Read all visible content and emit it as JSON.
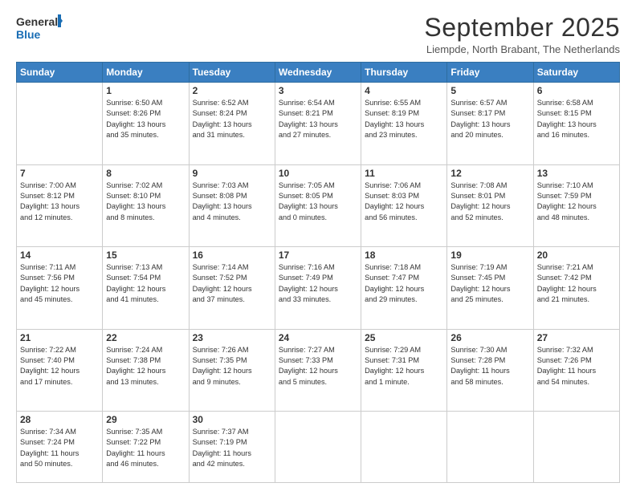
{
  "header": {
    "logo_line1": "General",
    "logo_line2": "Blue",
    "month": "September 2025",
    "location": "Liempde, North Brabant, The Netherlands"
  },
  "days_of_week": [
    "Sunday",
    "Monday",
    "Tuesday",
    "Wednesday",
    "Thursday",
    "Friday",
    "Saturday"
  ],
  "weeks": [
    [
      {
        "day": "",
        "info": ""
      },
      {
        "day": "1",
        "info": "Sunrise: 6:50 AM\nSunset: 8:26 PM\nDaylight: 13 hours\nand 35 minutes."
      },
      {
        "day": "2",
        "info": "Sunrise: 6:52 AM\nSunset: 8:24 PM\nDaylight: 13 hours\nand 31 minutes."
      },
      {
        "day": "3",
        "info": "Sunrise: 6:54 AM\nSunset: 8:21 PM\nDaylight: 13 hours\nand 27 minutes."
      },
      {
        "day": "4",
        "info": "Sunrise: 6:55 AM\nSunset: 8:19 PM\nDaylight: 13 hours\nand 23 minutes."
      },
      {
        "day": "5",
        "info": "Sunrise: 6:57 AM\nSunset: 8:17 PM\nDaylight: 13 hours\nand 20 minutes."
      },
      {
        "day": "6",
        "info": "Sunrise: 6:58 AM\nSunset: 8:15 PM\nDaylight: 13 hours\nand 16 minutes."
      }
    ],
    [
      {
        "day": "7",
        "info": "Sunrise: 7:00 AM\nSunset: 8:12 PM\nDaylight: 13 hours\nand 12 minutes."
      },
      {
        "day": "8",
        "info": "Sunrise: 7:02 AM\nSunset: 8:10 PM\nDaylight: 13 hours\nand 8 minutes."
      },
      {
        "day": "9",
        "info": "Sunrise: 7:03 AM\nSunset: 8:08 PM\nDaylight: 13 hours\nand 4 minutes."
      },
      {
        "day": "10",
        "info": "Sunrise: 7:05 AM\nSunset: 8:05 PM\nDaylight: 13 hours\nand 0 minutes."
      },
      {
        "day": "11",
        "info": "Sunrise: 7:06 AM\nSunset: 8:03 PM\nDaylight: 12 hours\nand 56 minutes."
      },
      {
        "day": "12",
        "info": "Sunrise: 7:08 AM\nSunset: 8:01 PM\nDaylight: 12 hours\nand 52 minutes."
      },
      {
        "day": "13",
        "info": "Sunrise: 7:10 AM\nSunset: 7:59 PM\nDaylight: 12 hours\nand 48 minutes."
      }
    ],
    [
      {
        "day": "14",
        "info": "Sunrise: 7:11 AM\nSunset: 7:56 PM\nDaylight: 12 hours\nand 45 minutes."
      },
      {
        "day": "15",
        "info": "Sunrise: 7:13 AM\nSunset: 7:54 PM\nDaylight: 12 hours\nand 41 minutes."
      },
      {
        "day": "16",
        "info": "Sunrise: 7:14 AM\nSunset: 7:52 PM\nDaylight: 12 hours\nand 37 minutes."
      },
      {
        "day": "17",
        "info": "Sunrise: 7:16 AM\nSunset: 7:49 PM\nDaylight: 12 hours\nand 33 minutes."
      },
      {
        "day": "18",
        "info": "Sunrise: 7:18 AM\nSunset: 7:47 PM\nDaylight: 12 hours\nand 29 minutes."
      },
      {
        "day": "19",
        "info": "Sunrise: 7:19 AM\nSunset: 7:45 PM\nDaylight: 12 hours\nand 25 minutes."
      },
      {
        "day": "20",
        "info": "Sunrise: 7:21 AM\nSunset: 7:42 PM\nDaylight: 12 hours\nand 21 minutes."
      }
    ],
    [
      {
        "day": "21",
        "info": "Sunrise: 7:22 AM\nSunset: 7:40 PM\nDaylight: 12 hours\nand 17 minutes."
      },
      {
        "day": "22",
        "info": "Sunrise: 7:24 AM\nSunset: 7:38 PM\nDaylight: 12 hours\nand 13 minutes."
      },
      {
        "day": "23",
        "info": "Sunrise: 7:26 AM\nSunset: 7:35 PM\nDaylight: 12 hours\nand 9 minutes."
      },
      {
        "day": "24",
        "info": "Sunrise: 7:27 AM\nSunset: 7:33 PM\nDaylight: 12 hours\nand 5 minutes."
      },
      {
        "day": "25",
        "info": "Sunrise: 7:29 AM\nSunset: 7:31 PM\nDaylight: 12 hours\nand 1 minute."
      },
      {
        "day": "26",
        "info": "Sunrise: 7:30 AM\nSunset: 7:28 PM\nDaylight: 11 hours\nand 58 minutes."
      },
      {
        "day": "27",
        "info": "Sunrise: 7:32 AM\nSunset: 7:26 PM\nDaylight: 11 hours\nand 54 minutes."
      }
    ],
    [
      {
        "day": "28",
        "info": "Sunrise: 7:34 AM\nSunset: 7:24 PM\nDaylight: 11 hours\nand 50 minutes."
      },
      {
        "day": "29",
        "info": "Sunrise: 7:35 AM\nSunset: 7:22 PM\nDaylight: 11 hours\nand 46 minutes."
      },
      {
        "day": "30",
        "info": "Sunrise: 7:37 AM\nSunset: 7:19 PM\nDaylight: 11 hours\nand 42 minutes."
      },
      {
        "day": "",
        "info": ""
      },
      {
        "day": "",
        "info": ""
      },
      {
        "day": "",
        "info": ""
      },
      {
        "day": "",
        "info": ""
      }
    ]
  ]
}
